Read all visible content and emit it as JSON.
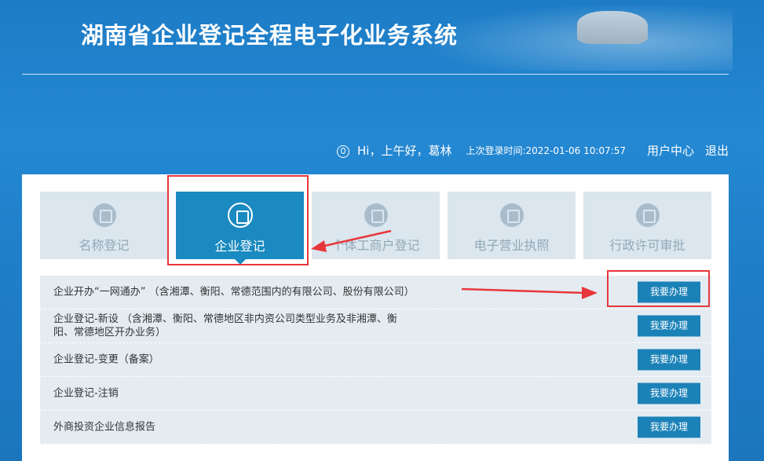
{
  "header": {
    "title": "湖南省企业登记全程电子化业务系统"
  },
  "userbar": {
    "greeting": "Hi，上午好，葛林",
    "last_login": "上次登录时间:2022-01-06 10:07:57",
    "user_center": "用户中心",
    "logout": "退出"
  },
  "tabs": [
    {
      "label": "名称登记",
      "icon": "document-icon",
      "active": false
    },
    {
      "label": "企业登记",
      "icon": "company-icon",
      "active": true
    },
    {
      "label": "个体工商户登记",
      "icon": "shop-icon",
      "active": false
    },
    {
      "label": "电子营业执照",
      "icon": "license-icon",
      "active": false
    },
    {
      "label": "行政许可审批",
      "icon": "person-icon",
      "active": false
    }
  ],
  "services": [
    {
      "text": "企业开办“一网通办” （含湘潭、衡阳、常德范围内的有限公司、股份有限公司）",
      "button": "我要办理"
    },
    {
      "text": "企业登记-新设 （含湘潭、衡阳、常德地区非内资公司类型业务及非湘潭、衡阳、常德地区开办业务）",
      "button": "我要办理"
    },
    {
      "text": "企业登记-变更（备案）",
      "button": "我要办理"
    },
    {
      "text": "企业登记-注销",
      "button": "我要办理"
    },
    {
      "text": "外商投资企业信息报告",
      "button": "我要办理"
    }
  ],
  "colors": {
    "accent": "#1a8ac0",
    "highlight": "#e8373a",
    "background": "#1f80c9"
  }
}
